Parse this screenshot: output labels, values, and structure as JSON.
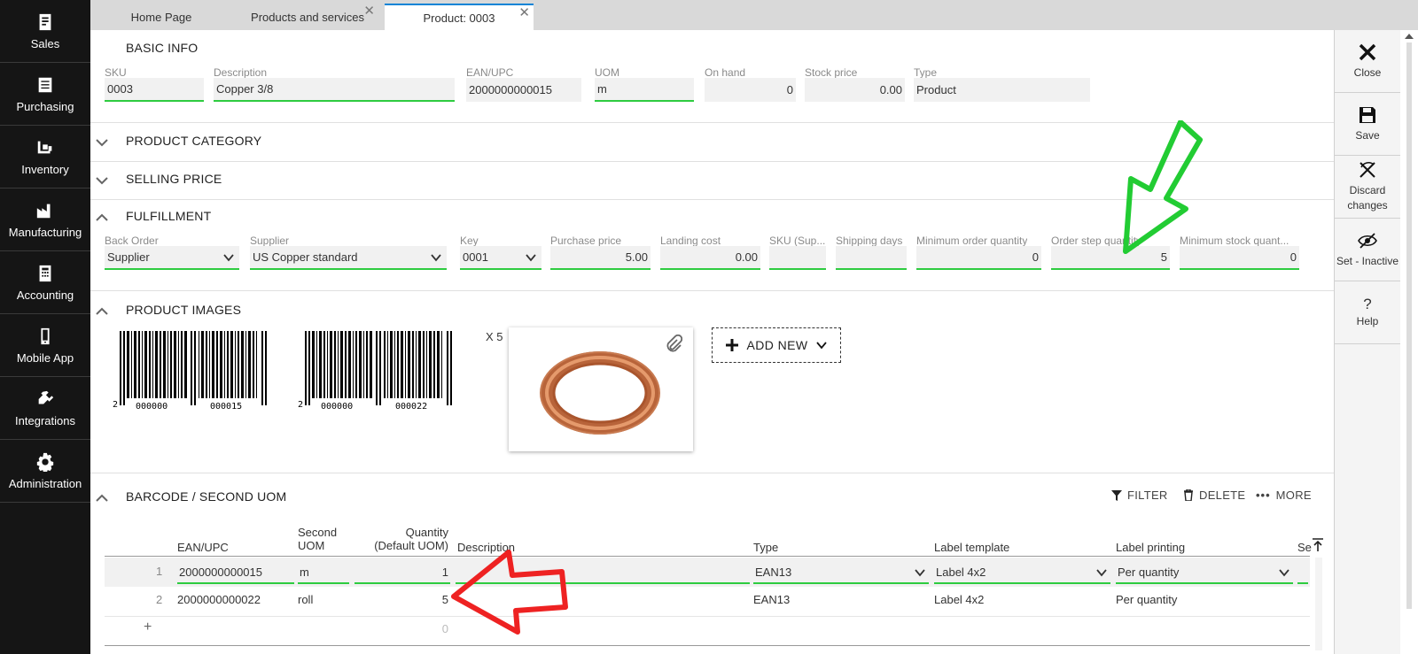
{
  "nav": {
    "items": [
      {
        "label": "Sales",
        "icon": "sales-icon"
      },
      {
        "label": "Purchasing",
        "icon": "purchasing-icon"
      },
      {
        "label": "Inventory",
        "icon": "inventory-icon"
      },
      {
        "label": "Manufacturing",
        "icon": "manufacturing-icon"
      },
      {
        "label": "Accounting",
        "icon": "accounting-icon"
      },
      {
        "label": "Mobile App",
        "icon": "mobile-icon"
      },
      {
        "label": "Integrations",
        "icon": "integrations-icon"
      },
      {
        "label": "Administration",
        "icon": "gear-icon"
      }
    ]
  },
  "tabs": [
    {
      "label": "Home Page"
    },
    {
      "label": "Products and services"
    },
    {
      "label": "Product: 0003"
    }
  ],
  "actions": {
    "close": "Close",
    "save": "Save",
    "discard": "Discard changes",
    "set_inactive": "Set - Inactive",
    "help": "Help"
  },
  "basic_info": {
    "title": "BASIC INFO",
    "sku_label": "SKU",
    "sku": "0003",
    "description_label": "Description",
    "description": "Copper 3/8",
    "ean_label": "EAN/UPC",
    "ean": "2000000000015",
    "uom_label": "UOM",
    "uom": "m",
    "onhand_label": "On hand",
    "onhand": "0",
    "stockprice_label": "Stock price",
    "stockprice": "0.00",
    "type_label": "Type",
    "type": "Product"
  },
  "sections": {
    "product_category": "PRODUCT CATEGORY",
    "selling_price": "SELLING PRICE",
    "fulfillment": "FULFILLMENT",
    "product_images": "PRODUCT IMAGES",
    "barcode": "BARCODE / SECOND UOM"
  },
  "fulfillment": {
    "backorder_label": "Back Order",
    "backorder": "Supplier",
    "supplier_label": "Supplier",
    "supplier": "US Copper standard",
    "key_label": "Key",
    "key": "0001",
    "purchase_label": "Purchase price",
    "purchase": "5.00",
    "landing_label": "Landing cost",
    "landing": "0.00",
    "skusup_label": "SKU (Sup...",
    "shipping_label": "Shipping days",
    "minorder_label": "Minimum order quantity",
    "minorder": "0",
    "orderstep_label": "Order step quantity",
    "orderstep": "5",
    "minstock_label": "Minimum stock quant...",
    "minstock": "0"
  },
  "images": {
    "barcode1_left": "2",
    "barcode1_a": "000000",
    "barcode1_b": "000015",
    "barcode2_left": "2",
    "barcode2_a": "000000",
    "barcode2_b": "000022",
    "multiplier": "X 5",
    "add_new": "ADD NEW"
  },
  "barcode_table": {
    "toolbar": {
      "filter": "FILTER",
      "delete": "DELETE",
      "more": "MORE"
    },
    "headers": {
      "ean": "EAN/UPC",
      "second_uom_1": "Second",
      "second_uom_2": "UOM",
      "qty_1": "Quantity",
      "qty_2": "(Default UOM)",
      "description": "Description",
      "type": "Type",
      "label_template": "Label template",
      "label_printing": "Label printing",
      "se": "Se"
    },
    "rows": [
      {
        "num": "1",
        "ean": "2000000000015",
        "uom": "m",
        "qty": "1",
        "type": "EAN13",
        "template": "Label 4x2",
        "printing": "Per quantity"
      },
      {
        "num": "2",
        "ean": "2000000000022",
        "uom": "roll",
        "qty": "5",
        "type": "EAN13",
        "template": "Label 4x2",
        "printing": "Per quantity"
      }
    ],
    "new_row": {
      "plus": "+",
      "qty": "0"
    }
  },
  "colors": {
    "accent": "#0a84d6",
    "valid": "#2ecc40",
    "nav_bg": "#151515",
    "arrow_green": "#22cc33",
    "arrow_red": "#ee2222"
  }
}
